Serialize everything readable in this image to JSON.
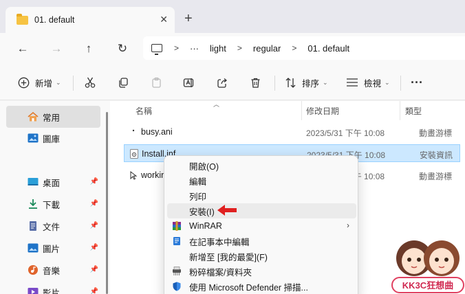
{
  "tab": {
    "title": "01. default",
    "close": "✕",
    "new_tab": "+"
  },
  "nav": {
    "back": "←",
    "forward": "→",
    "up": "↑",
    "refresh": "↻"
  },
  "address": {
    "overflow": "···",
    "breadcrumbs": [
      "light",
      "regular",
      "01. default"
    ],
    "sep": ">"
  },
  "toolbar": {
    "new_label": "新增",
    "sort_label": "排序",
    "view_label": "檢視",
    "more_label": "···"
  },
  "sidebar": {
    "items": [
      {
        "label": "常用",
        "pinned": false
      },
      {
        "label": "圖庫",
        "pinned": false
      },
      {
        "label": "桌面",
        "pinned": true
      },
      {
        "label": "下載",
        "pinned": true
      },
      {
        "label": "文件",
        "pinned": true
      },
      {
        "label": "圖片",
        "pinned": true
      },
      {
        "label": "音樂",
        "pinned": true
      },
      {
        "label": "影片",
        "pinned": true
      }
    ]
  },
  "columns": {
    "name": "名稱",
    "date": "修改日期",
    "type": "類型"
  },
  "files": [
    {
      "name": "busy.ani",
      "date": "2023/5/31 下午 10:08",
      "type": "動畫游標",
      "selected": false
    },
    {
      "name": "Install.inf",
      "date": "2023/5/31 下午 10:08",
      "type": "安裝資訊",
      "selected": true
    },
    {
      "name": "working.ani",
      "date": "2023/5/31 下午 10:08",
      "type": "動畫游標",
      "selected": false
    }
  ],
  "context_menu": {
    "items": [
      {
        "label": "開啟(O)"
      },
      {
        "label": "編輯"
      },
      {
        "label": "列印"
      },
      {
        "label": "安裝(I)"
      },
      {
        "label": "WinRAR",
        "submenu": "›"
      },
      {
        "label": "在記事本中編輯"
      },
      {
        "label": "新增至 [我的最愛](F)"
      },
      {
        "label": "粉碎檔案/資料夾"
      },
      {
        "label": "使用 Microsoft Defender 掃描..."
      }
    ]
  },
  "watermark": {
    "text": "KK3C狂想曲"
  },
  "colors": {
    "selection": "#cce8ff",
    "accent": "#0067c0",
    "arrow": "#e02020"
  }
}
